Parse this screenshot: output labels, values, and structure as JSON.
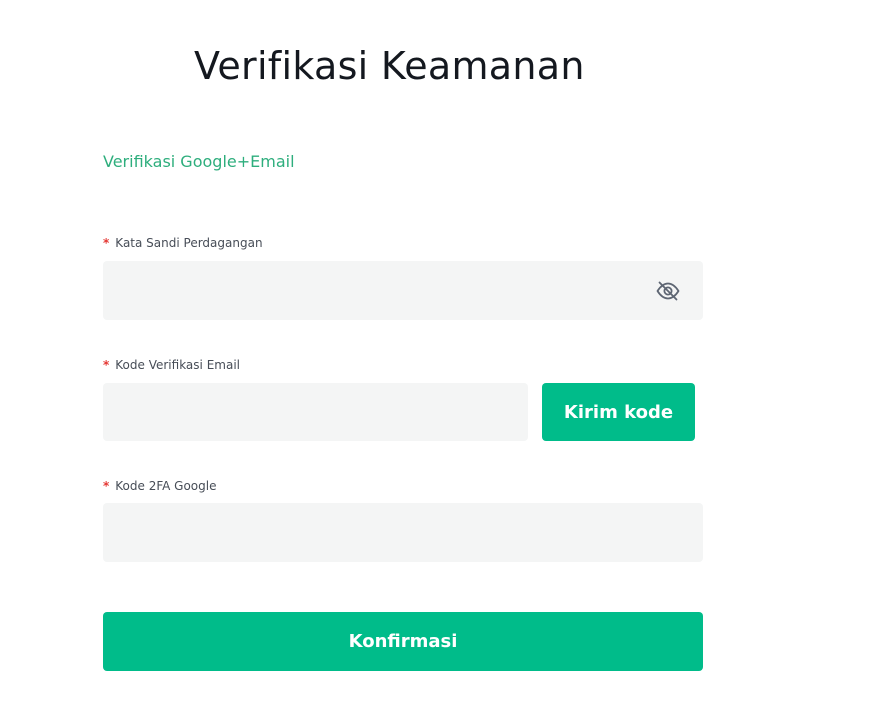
{
  "page": {
    "title": "Verifikasi Keamanan"
  },
  "method_tab": {
    "label": "Verifikasi Google+Email"
  },
  "required_marker": "*",
  "fields": {
    "trading_password": {
      "label": "Kata Sandi Perdagangan",
      "value": "",
      "placeholder": "",
      "visibility_icon": "eye-slash-icon"
    },
    "email_code": {
      "label": "Kode Verifikasi Email",
      "value": "",
      "placeholder": "",
      "send_button_label": "Kirim kode"
    },
    "google_2fa": {
      "label": "Kode 2FA Google",
      "value": "",
      "placeholder": ""
    }
  },
  "confirm_button": {
    "label": "Konfirmasi"
  },
  "colors": {
    "accent": "#00bc8a",
    "accent_text": "#2eae7d",
    "input_bg": "#f4f5f5",
    "required": "#e53935",
    "title": "#14181f",
    "label": "#474d57"
  }
}
